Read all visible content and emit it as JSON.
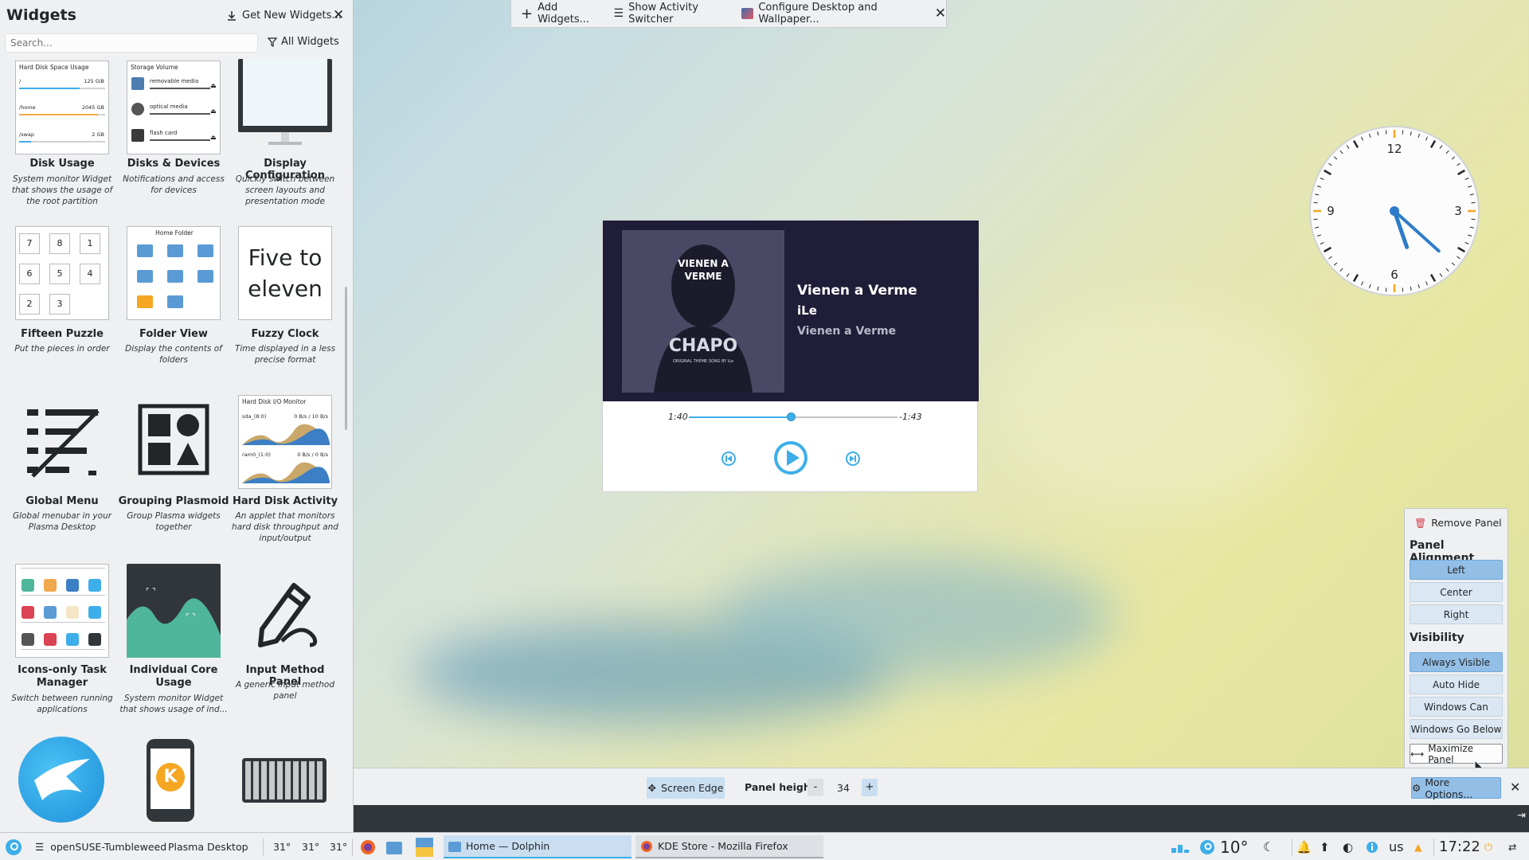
{
  "explorer": {
    "title": "Widgets",
    "get_new_label": "Get New Widgets...",
    "search_placeholder": "Search...",
    "filter_label": "All Widgets",
    "widgets": [
      {
        "name": "Disk Usage",
        "desc": "System monitor Widget that shows the usage of the root partition",
        "thumb": {
          "title": "Hard Disk Space Usage",
          "rows": [
            {
              "path": "/",
              "size": "125 GiB"
            },
            {
              "path": "/home",
              "size": "2045 GB"
            },
            {
              "path": "/swap",
              "size": "2 GB"
            }
          ]
        }
      },
      {
        "name": "Disks & Devices",
        "desc": "Notifications and access for devices",
        "thumb": {
          "title": "Storage Volume",
          "rows": [
            {
              "label": "removable media"
            },
            {
              "label": "optical media"
            },
            {
              "label": "flash card"
            }
          ]
        }
      },
      {
        "name": "Display Configuration",
        "desc": "Quickly switch between screen layouts and presentation mode"
      },
      {
        "name": "Fifteen Puzzle",
        "desc": "Put the pieces in order",
        "thumb": {
          "tiles": [
            "7",
            "8",
            "1",
            "6",
            "5",
            "4",
            "2",
            "3"
          ]
        }
      },
      {
        "name": "Folder View",
        "desc": "Display the contents of folders",
        "thumb": {
          "title": "Home Folder"
        }
      },
      {
        "name": "Fuzzy Clock",
        "desc": "Time displayed in a less precise format",
        "thumb": {
          "text": "Five to eleven"
        }
      },
      {
        "name": "Global Menu",
        "desc": "Global menubar in your Plasma Desktop"
      },
      {
        "name": "Grouping Plasmoid",
        "desc": "Group Plasma widgets together"
      },
      {
        "name": "Hard Disk Activity",
        "desc": "An applet that monitors hard disk throughput and input/output",
        "thumb": {
          "title": "Hard Disk I/O Monitor",
          "row1": "sda_(8:0)",
          "row1_val": "0 B/s / 10 B/s",
          "row2": "ram0_(1:0)",
          "row2_val": "0 B/s / 0 B/s"
        }
      },
      {
        "name": "Icons-only Task Manager",
        "desc": "Switch between running applications"
      },
      {
        "name": "Individual Core Usage",
        "desc": "System monitor Widget that shows usage of ind..."
      },
      {
        "name": "Input Method Panel",
        "desc": "A generic input method panel"
      }
    ]
  },
  "desktop_toolbar": {
    "add_widgets": "Add Widgets...",
    "activity_switcher": "Show Activity Switcher",
    "configure": "Configure Desktop and Wallpaper..."
  },
  "player": {
    "title": "Vienen a Verme",
    "artist": "iLe",
    "album": "Vienen a Verme",
    "cover_text_top": "VIENEN A VERME",
    "cover_text_main": "CHAPO",
    "cover_text_sub": "ORIGINAL THEME SONG BY iLe",
    "elapsed": "1:40",
    "remaining": "-1:43",
    "progress_fraction": 0.49
  },
  "clock": {
    "numerals": [
      "12",
      "3",
      "6",
      "9"
    ],
    "time": "17:22"
  },
  "panel_menu": {
    "remove": "Remove Panel",
    "alignment_heading": "Panel Alignment",
    "alignment_options": [
      "Left",
      "Center",
      "Right"
    ],
    "alignment_selected": "Left",
    "visibility_heading": "Visibility",
    "visibility_options": [
      "Always Visible",
      "Auto Hide",
      "Windows Can Cover",
      "Windows Go Below"
    ],
    "visibility_selected": "Always Visible",
    "maximize": "Maximize Panel"
  },
  "panel_config": {
    "screen_edge": "Screen Edge",
    "height_label": "Panel height:",
    "minus": "-",
    "height_value": "34",
    "plus": "+",
    "more_options": "More Options..."
  },
  "taskbar": {
    "distro": "openSUSE-Tumbleweed",
    "desktop": "Plasma Desktop",
    "temps": [
      "31°",
      "31°",
      "31°"
    ],
    "tasks": [
      {
        "label": "Home — Dolphin",
        "active": true
      },
      {
        "label": "KDE Store - Mozilla Firefox",
        "active": false
      }
    ],
    "weather": "10°",
    "keyboard": "us",
    "clock": "17:22"
  },
  "colors": {
    "accent": "#3daee9",
    "selected": "#93bfe6",
    "player_bg": "#1f1d37",
    "panel_bg": "#eff0f1"
  }
}
